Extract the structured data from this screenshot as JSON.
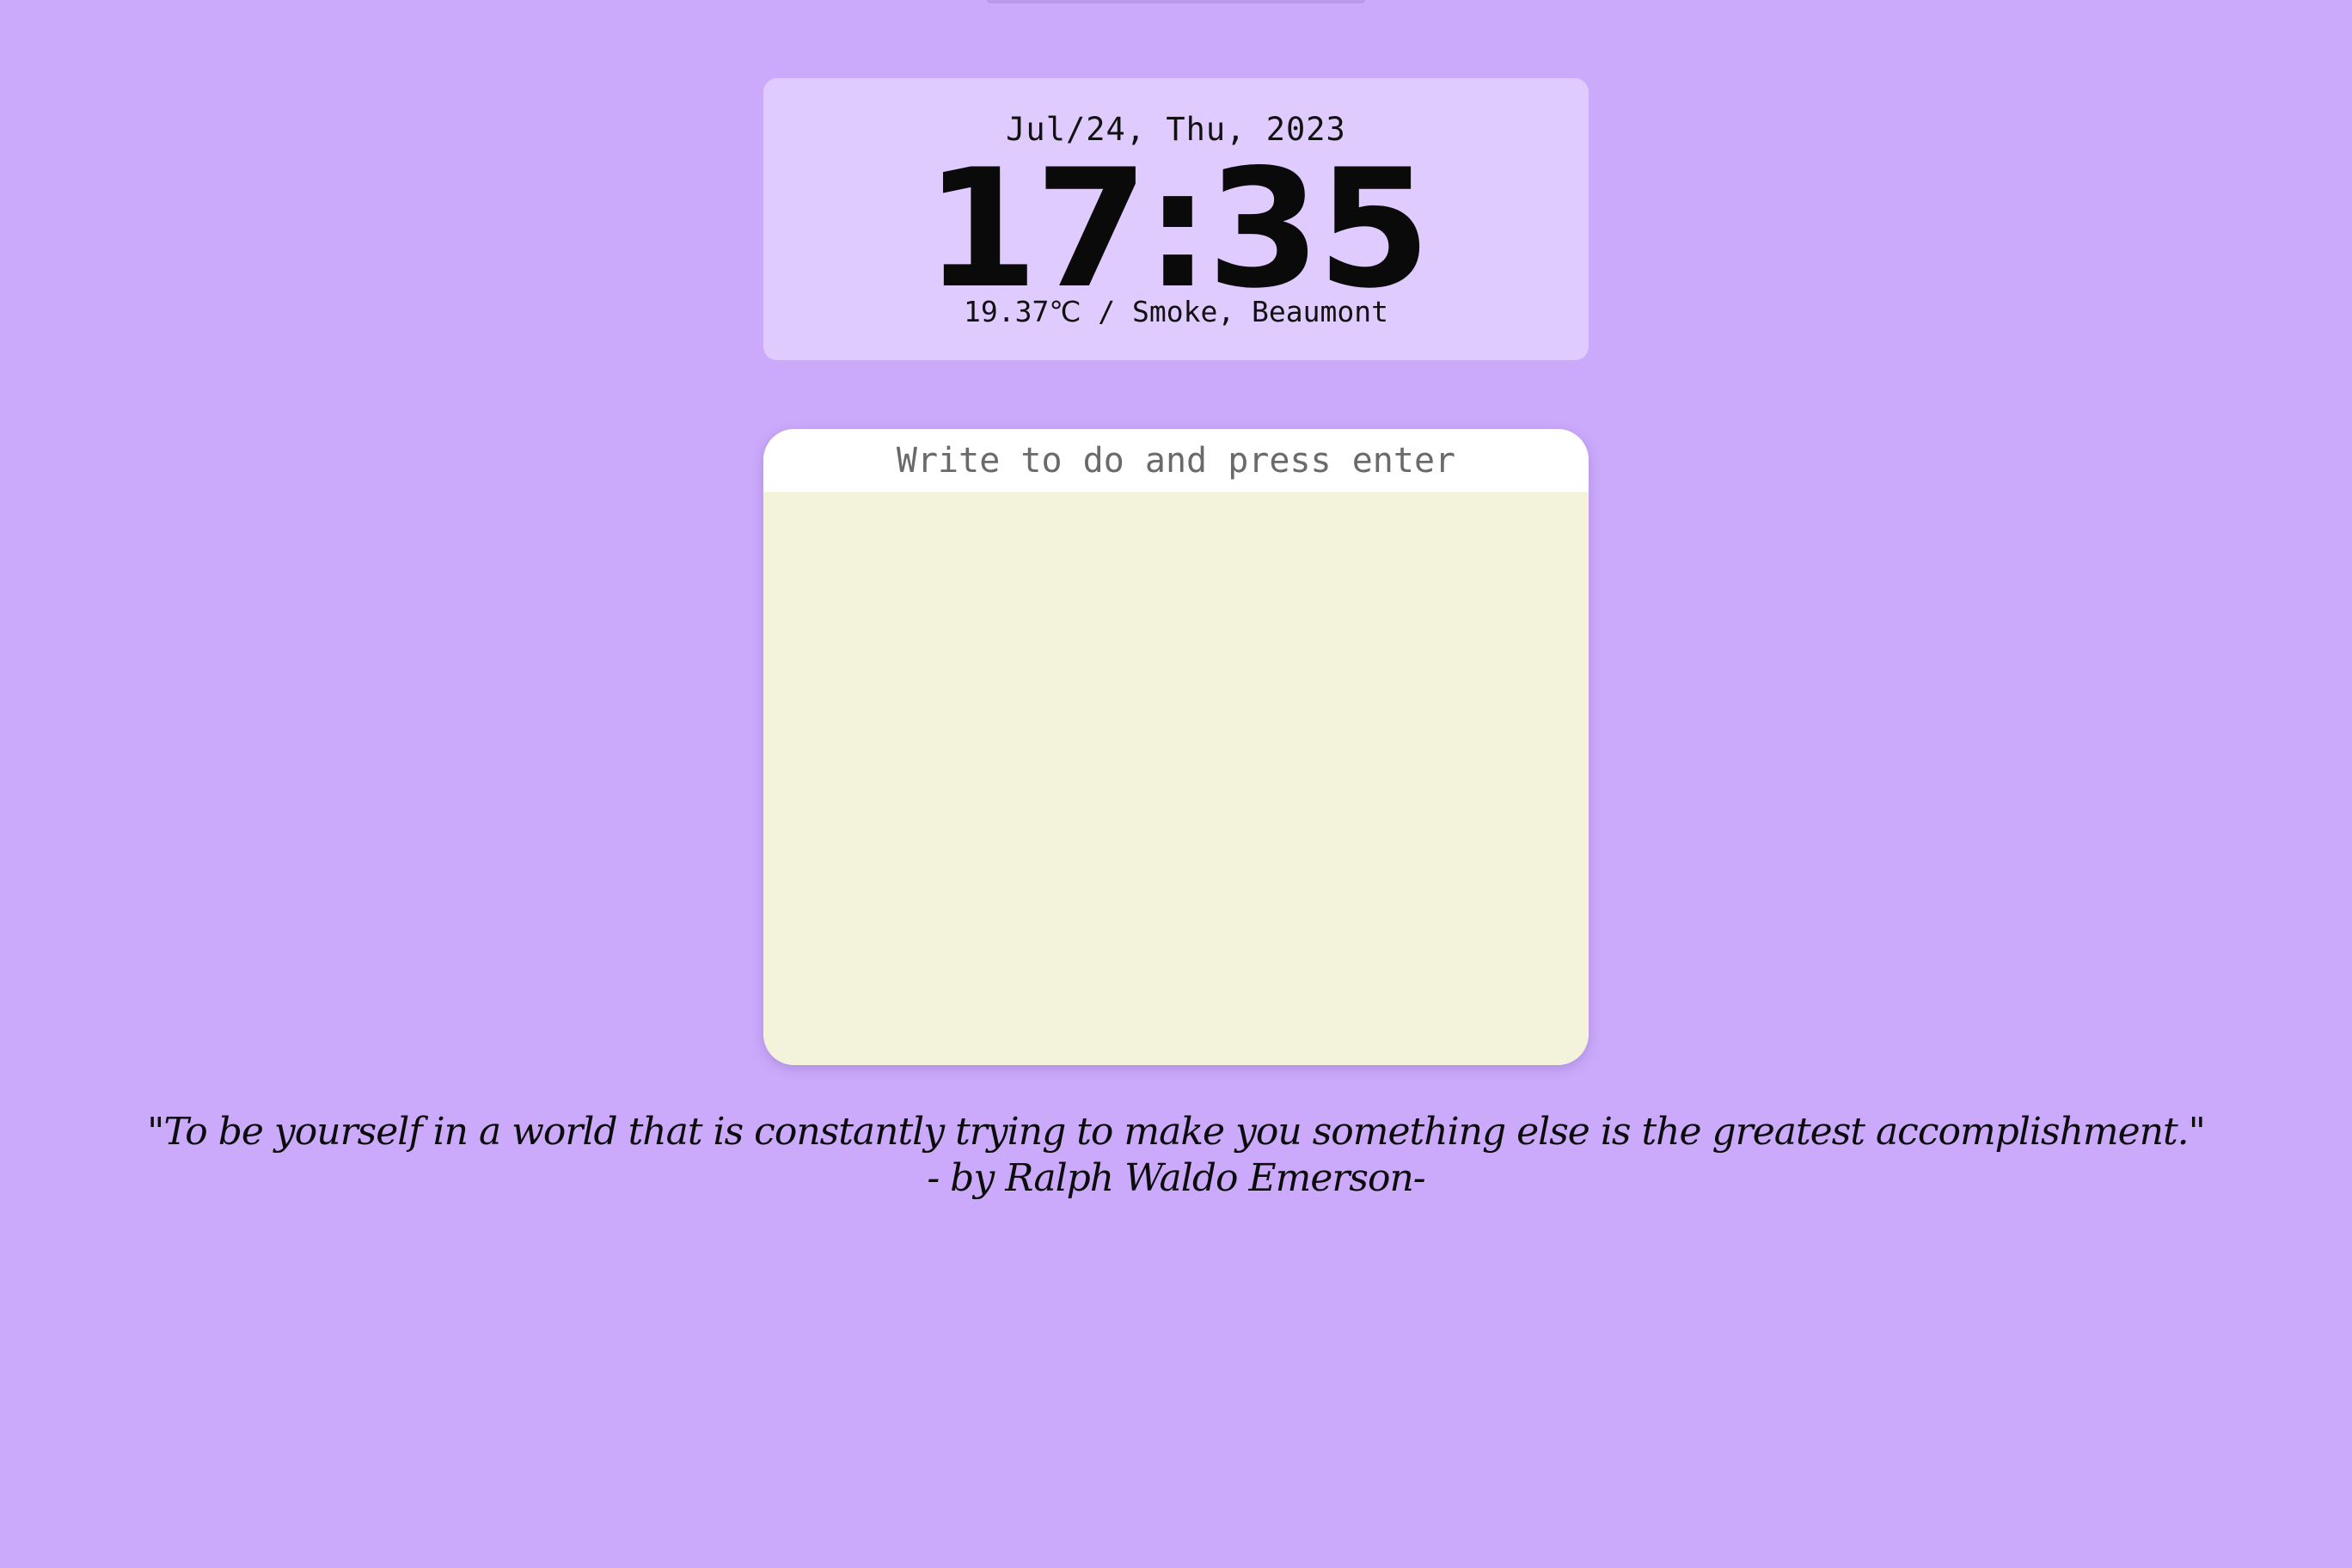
{
  "clock": {
    "date": "Jul/24, Thu, 2023",
    "time": "17:35",
    "weather": "19.37℃ / Smoke, Beaumont"
  },
  "todo": {
    "placeholder": "Write to do and press enter",
    "items": []
  },
  "quote": {
    "text": "\"To be yourself in a world that is constantly trying to make you something else is the greatest accomplishment.\"",
    "author": "- by Ralph Waldo Emerson-"
  },
  "colors": {
    "background": "#cbaafc",
    "clock_card": "#dfcbfd",
    "todo_list": "#f3f3dc",
    "todo_input": "#ffffff"
  }
}
